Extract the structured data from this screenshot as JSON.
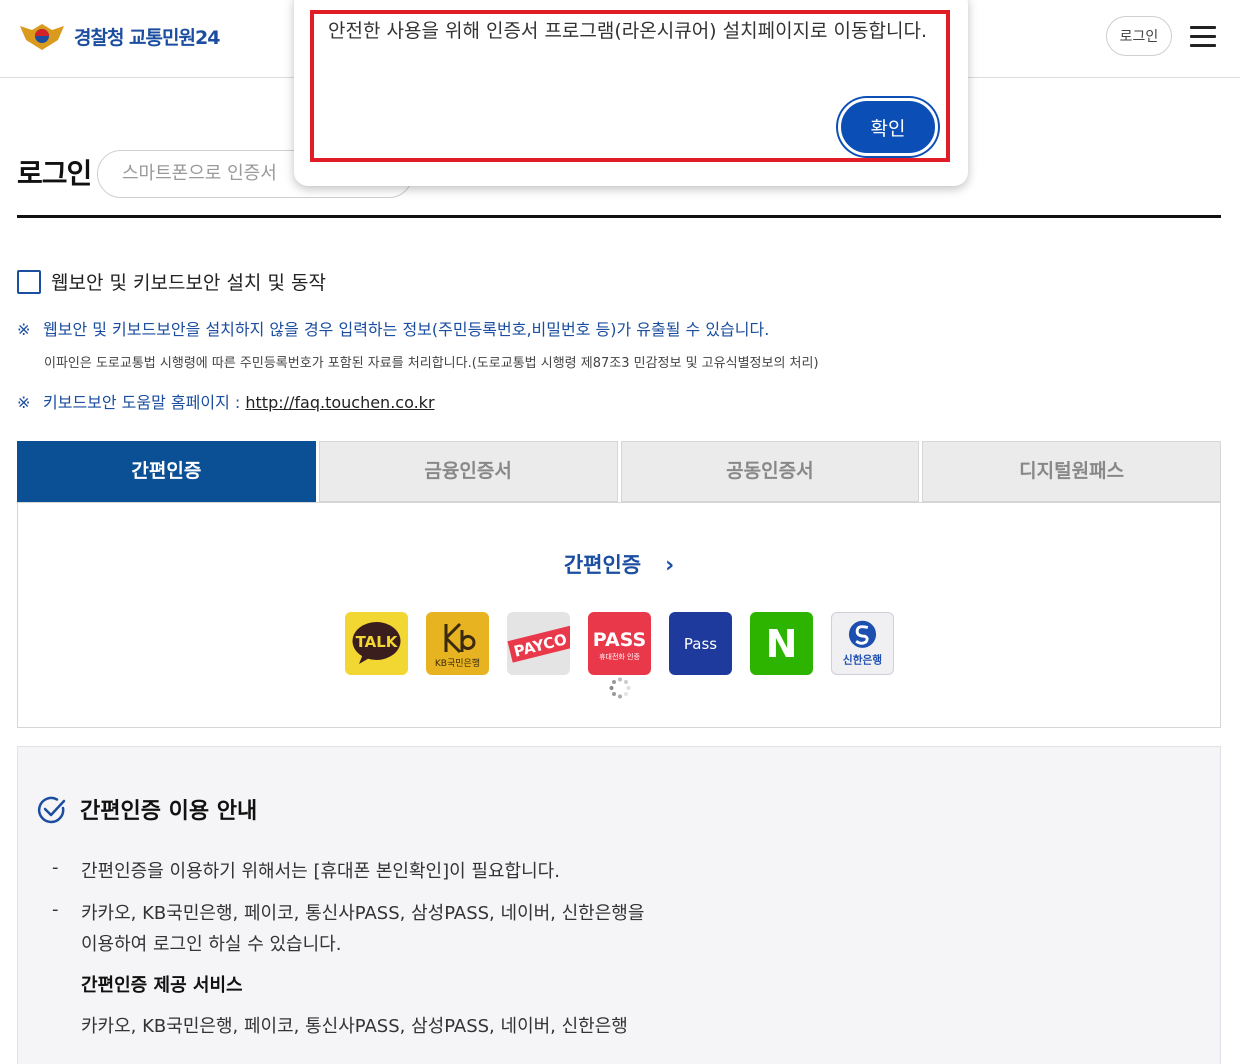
{
  "header": {
    "logo_text": "경찰청 교통민원24",
    "login_button": "로그인"
  },
  "page": {
    "title": "로그인",
    "smart_pill": "스마트폰으로 인증서",
    "checkbox_label": "웹보안 및 키보드보안 설치 및 동작",
    "notice1_mark": "※",
    "notice1": "웹보안 및 키보드보안을 설치하지 않을 경우 입력하는 정보(주민등록번호,비밀번호 등)가 유출될 수 있습니다.",
    "notice_sub": "이파인은 도로교통법 시행령에 따른 주민등록번호가 포함된 자료를 처리합니다.(도로교통법 시행령 제87조3 민감정보 및 고유식별정보의 처리)",
    "notice2_mark": "※",
    "notice2_label": "키보드보안 도움말 홈페이지",
    "notice2_colon": " : ",
    "notice2_link": "http://faq.touchen.co.kr"
  },
  "tabs": [
    "간편인증",
    "금융인증서",
    "공동인증서",
    "디지털원패스"
  ],
  "panel": {
    "title": "간편인증",
    "chevron": "›",
    "providers": [
      {
        "name": "kakao",
        "label": "TALK",
        "bg": "#f2d631"
      },
      {
        "name": "kb",
        "label": "KB국민은행",
        "bg": "#e7b321"
      },
      {
        "name": "payco",
        "label": "PAYCO",
        "bg": "#e4e4e4"
      },
      {
        "name": "pass-telecom",
        "label": "PASS",
        "sub": "휴대전화 인증",
        "bg": "#e8384a"
      },
      {
        "name": "pass-samsung",
        "label": "Pass",
        "bg": "#1d3a9c"
      },
      {
        "name": "naver",
        "label": "N",
        "bg": "#2db400"
      },
      {
        "name": "shinhan",
        "label": "신한은행",
        "bg": "#f0f0f2"
      }
    ]
  },
  "info": {
    "title": "간편인증 이용 안내",
    "dash": "-",
    "line1": "간편인증을 이용하기 위해서는 [휴대폰 본인확인]이 필요합니다.",
    "line2a": "카카오, KB국민은행, 페이코, 통신사PASS, 삼성PASS, 네이버, 신한은행을",
    "line2b": "이용하여 로그인 하실 수 있습니다.",
    "sub_title": "간편인증 제공 서비스",
    "sub_line": "카카오, KB국민은행, 페이코, 통신사PASS, 삼성PASS, 네이버, 신한은행"
  },
  "modal": {
    "message": "안전한 사용을 위해 인증서 프로그램(라온시큐어) 설치페이지로 이동합니다.",
    "confirm": "확인"
  },
  "colors": {
    "brand": "#1b4ea0",
    "tab_active": "#0b4f95",
    "confirm": "#0b4fb6",
    "highlight_red": "#e01c24"
  }
}
